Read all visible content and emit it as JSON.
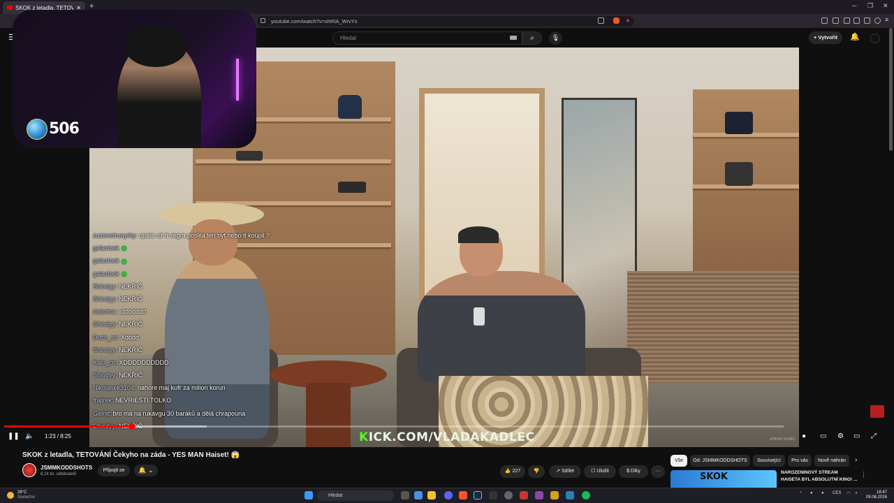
{
  "browser": {
    "tab_title": "SKOK z letadla, TETOVÁNÍ Če...",
    "url": "youtube.com/watch?v=xhRIA_WrvYs",
    "new_tab": "+"
  },
  "youtube": {
    "search_placeholder": "Hledat",
    "create_label": "+ Vytvořit"
  },
  "overlay": {
    "viewer_count": "506",
    "watermark": "ZHENI SUBS",
    "kick_text": "ICK.COM/VLADAKADLEC",
    "kick_k": "K"
  },
  "chat": [
    {
      "user": "zuzanetrunyrky:",
      "text": "opate už ti ségra poslila ten byt nebo ti koupil ?"
    },
    {
      "user": "galaxicek",
      "text": "",
      "emote": true
    },
    {
      "user": "galaxicek",
      "text": "",
      "emote": true
    },
    {
      "user": "galaxicek",
      "text": "",
      "emote": true
    },
    {
      "user": "Shindyy:",
      "text": "NEKŘIČ"
    },
    {
      "user": "Shindyy:",
      "text": "NEKŘIČ"
    },
    {
      "user": "dubnica:",
      "text": "xddddddd"
    },
    {
      "user": "Shindyy:",
      "text": "NEKŘIČ"
    },
    {
      "user": "Duco_sv:",
      "text": "Xdddd"
    },
    {
      "user": "Shindyy:",
      "text": "NEKŘIČ"
    },
    {
      "user": "Kalu_cn:",
      "text": "XDDDDDDDDDD"
    },
    {
      "user": "Shindyy:",
      "text": "NEKŘIČ"
    },
    {
      "user": "Nikolasek3104:",
      "text": "nahore maj kufr za milion korun"
    },
    {
      "user": "frajirek:",
      "text": "NEVRIEŠTI TOLKO"
    },
    {
      "user": "Gelnit:",
      "text": "bro má na rukávgu 30 baráků a dělá chrapouna"
    },
    {
      "user": "Shindyy:",
      "text": "NEKŘIČ"
    }
  ],
  "player": {
    "time": "1:23 / 8:25",
    "progress_fraction": 0.164,
    "buffer_fraction": 0.26
  },
  "video": {
    "title": "SKOK z letadla, TETOVÁNÍ Čekyho na záda - YES MAN Haiset! 😱",
    "channel": "JSMMKODDSHOTS",
    "subscribers": "8,24 tis. odběratelů",
    "join_label": "Připojit se",
    "likes": "227",
    "share_label": "Sdílet",
    "save_label": "Uložit",
    "thanks_label": "Díky",
    "more_label": "···"
  },
  "chips": [
    "Vše",
    "Od: JSMMKODDSHOTS",
    "Související",
    "Pro vás",
    "Nově nahrán"
  ],
  "recommendation": {
    "thumb_text": "SKOK",
    "title_line1": "NAROZENINOVÝ STREAM",
    "title_line2": "HAISETA BYL ABSOLUTNÍ KINO! ..."
  },
  "taskbar": {
    "temp": "28°C",
    "weather": "Slunečno",
    "search": "Hledat",
    "lang": "CES",
    "time": "18:47",
    "date": "09.08.2026"
  }
}
